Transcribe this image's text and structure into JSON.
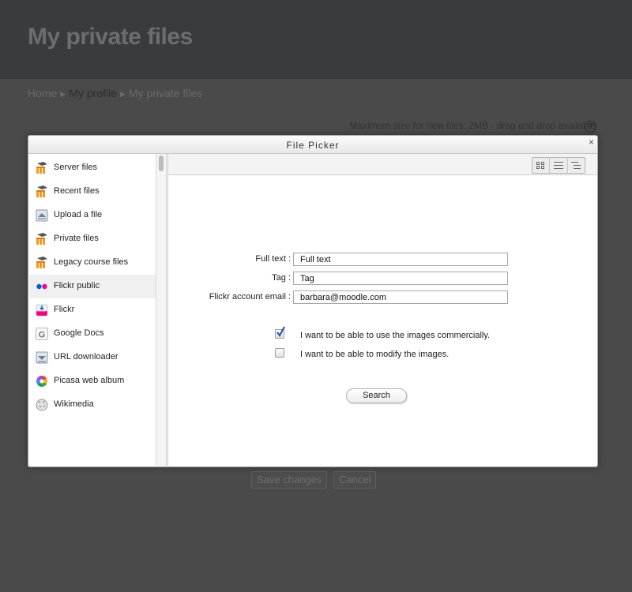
{
  "page": {
    "title": "My private files",
    "breadcrumb": [
      "Home",
      "My profile",
      "My private files"
    ],
    "max_size_text": "Maximum size for new files: 2MB - drag and drop available",
    "help_glyph": "?",
    "save_label": "Save changes",
    "cancel_label": "Cancel"
  },
  "dialog": {
    "title": "File Picker",
    "close_glyph": "×"
  },
  "sidebar": {
    "items": [
      {
        "label": "Server files",
        "icon": "moodle-icon"
      },
      {
        "label": "Recent files",
        "icon": "moodle-icon"
      },
      {
        "label": "Upload a file",
        "icon": "upload-icon"
      },
      {
        "label": "Private files",
        "icon": "moodle-icon"
      },
      {
        "label": "Legacy course files",
        "icon": "moodle-icon"
      },
      {
        "label": "Flickr public",
        "icon": "flickr-icon"
      },
      {
        "label": "Flickr",
        "icon": "flickr-pink-icon"
      },
      {
        "label": "Google Docs",
        "icon": "google-icon"
      },
      {
        "label": "URL downloader",
        "icon": "download-icon"
      },
      {
        "label": "Picasa web album",
        "icon": "picasa-icon"
      },
      {
        "label": "Wikimedia",
        "icon": "wikimedia-icon"
      }
    ],
    "active_index": 5
  },
  "form": {
    "fulltext_label": "Full text :",
    "fulltext_value": "Full text",
    "tag_label": "Tag :",
    "tag_value": "Tag",
    "email_label": "Flickr account email :",
    "email_value": "barbara@moodle.com",
    "commercial_label": "I want to be able to use the images commercially.",
    "commercial_checked": true,
    "modify_label": "I want to be able to modify the images.",
    "modify_checked": false,
    "search_label": "Search"
  },
  "colors": {
    "header_bg": "#3a3b3d",
    "page_bg": "#4a4a4a",
    "check_color": "#2a5aa8",
    "moodle_orange": "#f29a1e",
    "flickr_blue": "#0063dc",
    "flickr_pink": "#ff0084"
  }
}
